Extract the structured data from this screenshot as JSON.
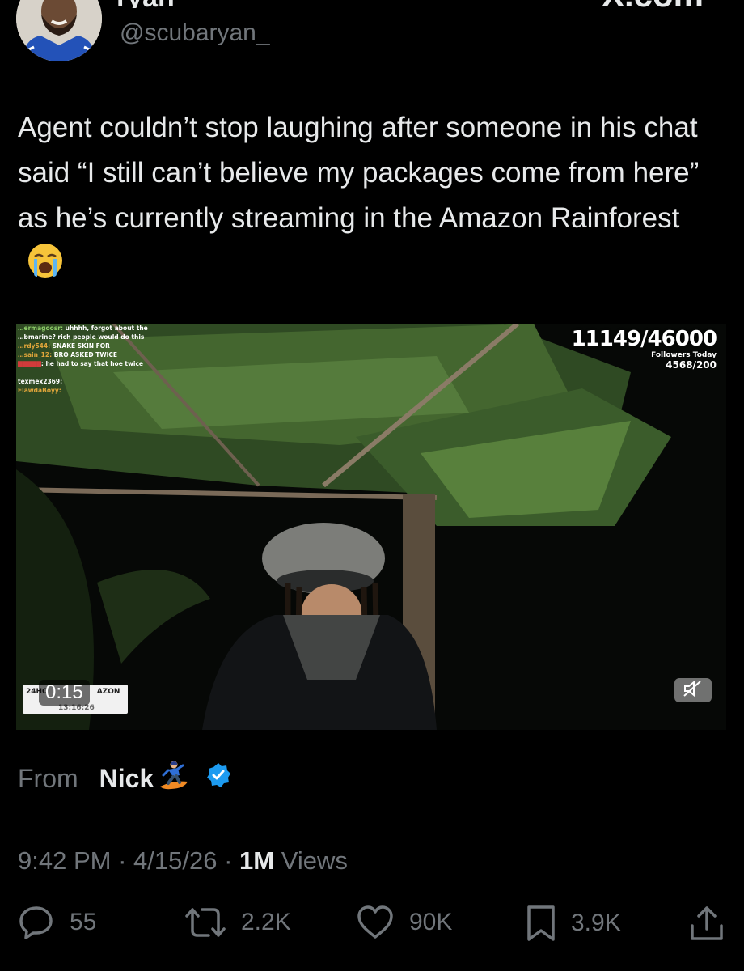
{
  "tweet": {
    "author_handle": "@scubaryan_",
    "text": "Agent couldn’t stop laughing after someone in his chat said “I still can’t believe my packages come from here” as he’s currently streaming in the Amazon Rainforest",
    "text_emoji": "loudly-crying-face-emoji",
    "video": {
      "chat_lines": [
        {
          "user": "…ermagoosr:",
          "msg": "uhhhh, forgot about the"
        },
        {
          "user": "",
          "msg": "…bmarine? rich people would do this"
        },
        {
          "user": "…rdy544:",
          "msg": "SNAKE SKIN FOR"
        },
        {
          "user": "…sain_12:",
          "msg": "BRO ASKED TWICE"
        },
        {
          "user": "",
          "msg": ": he had to say that hoe twice"
        },
        {
          "user": "texmex2369:",
          "msg": ""
        },
        {
          "user": "FlawdaBoyy:",
          "msg": ""
        }
      ],
      "counter": {
        "main": "11149/46000",
        "label": "Followers Today",
        "value": "4568/200"
      },
      "mini_bar": {
        "line1": "24HO",
        "line1_tail": "AZON",
        "line2": "13:16:26"
      },
      "elapsed": "0:15",
      "mute_icon": "speaker-muted-icon"
    },
    "source": {
      "from_label": "From",
      "name": "Nick",
      "name_emoji": "snowboarder-emoji",
      "verified_icon": "verified-badge-icon"
    },
    "meta": {
      "time": "9:42 PM",
      "sep1": " · ",
      "date": "4/15/26",
      "sep2": " · ",
      "views_count": "1M",
      "views_label": " Views"
    },
    "actions": {
      "replies": "55",
      "reposts": "2.2K",
      "likes": "90K",
      "bookmarks": "3.9K"
    }
  },
  "colors": {
    "background": "#000000",
    "text_primary": "#e7e9ea",
    "text_secondary": "#71767b",
    "verified_blue": "#1d9bf0"
  }
}
